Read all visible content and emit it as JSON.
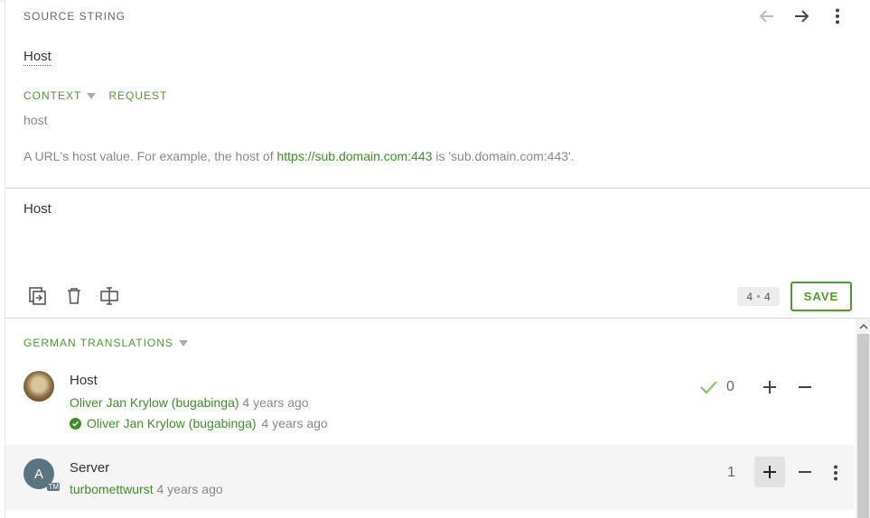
{
  "source": {
    "header": "SOURCE STRING",
    "text": "Host",
    "tabs": [
      {
        "label": "CONTEXT",
        "caret": true
      },
      {
        "label": "REQUEST",
        "caret": false
      }
    ],
    "context_value": "host",
    "comment_before": "A URL's host value. For example, the host of ",
    "comment_link": "https://sub.domain.com:443",
    "comment_after": " is 'sub.domain.com:443'."
  },
  "editor": {
    "text": "Host",
    "counter_left": "4",
    "counter_right": "4",
    "save_label": "SAVE"
  },
  "translations": {
    "header": "GERMAN TRANSLATIONS",
    "items": [
      {
        "text": "Host",
        "author": "Oliver Jan Krylow (bugabinga)",
        "time": "4 years ago",
        "approver": "Oliver Jan Krylow (bugabinga)",
        "approved_time": "4 years ago",
        "votes": "0"
      },
      {
        "text": "Server",
        "avatar_initial": "A",
        "avatar_badge": "TM",
        "author": "turbomettwurst",
        "time": "4 years ago",
        "votes": "1"
      }
    ]
  },
  "colors": {
    "accent": "#4d9a2e",
    "link": "#3c8f25",
    "muted": "#888888"
  },
  "icons": [
    "arrow-left-icon",
    "arrow-right-icon",
    "more-vert-icon",
    "copy-icon",
    "trash-icon",
    "special-chars-icon",
    "check-icon",
    "plus-icon",
    "minus-icon",
    "approved-icon"
  ]
}
